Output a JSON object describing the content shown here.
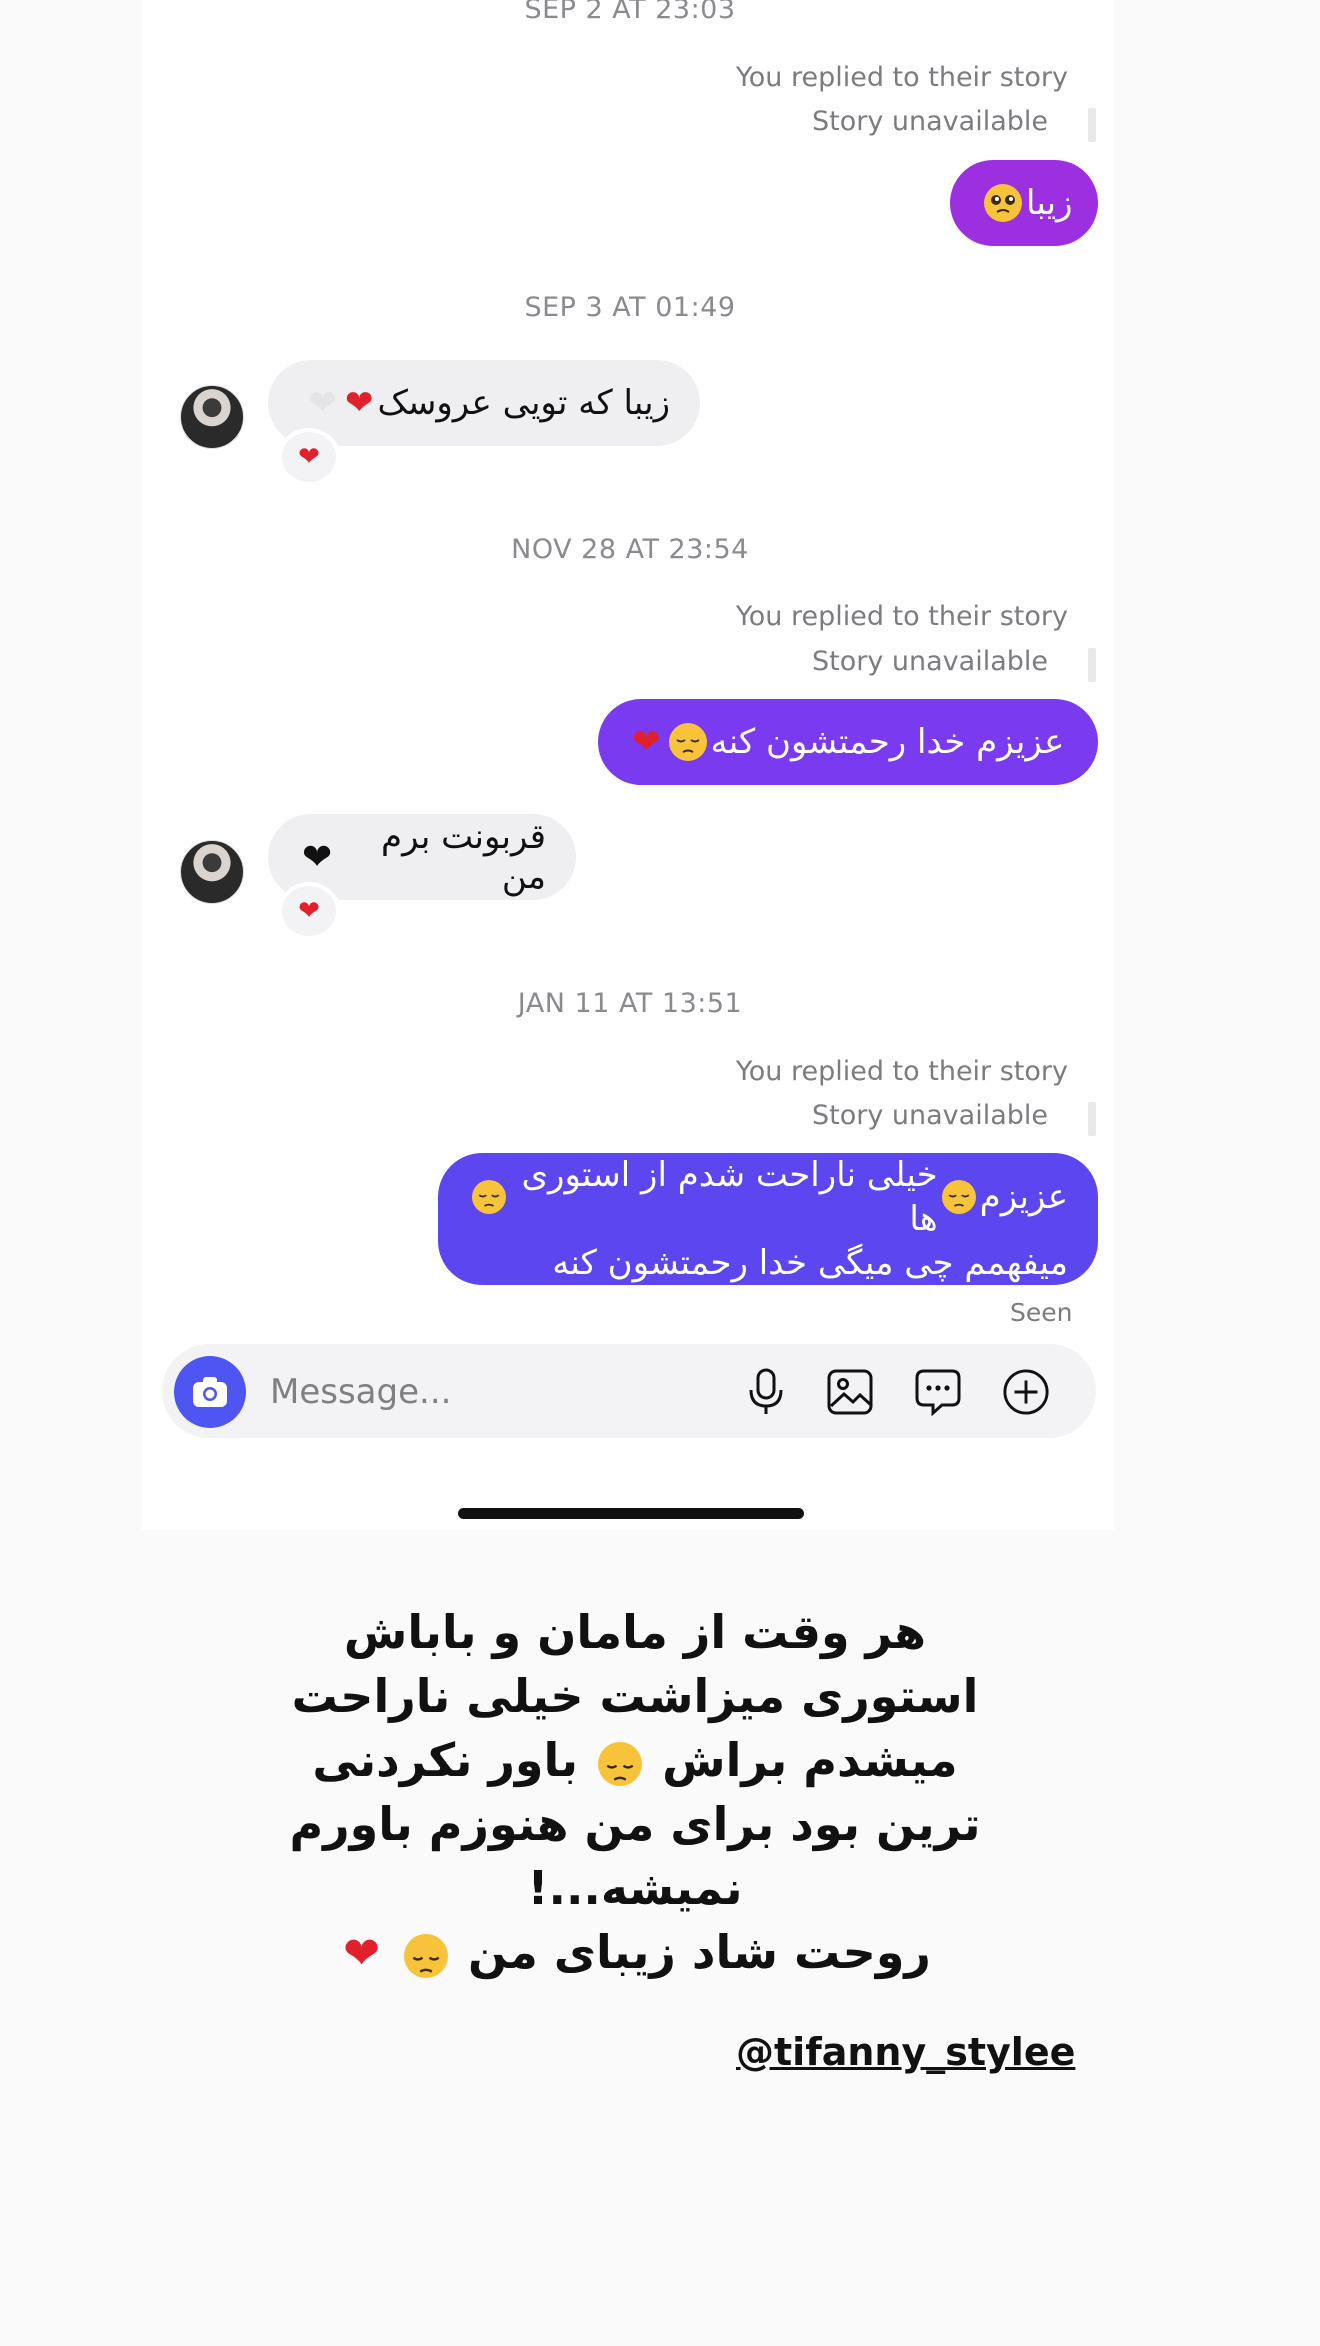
{
  "thread": {
    "groups": [
      {
        "date": "SEP 2 AT 23:03",
        "reply_note": "You replied to their story",
        "story_status": "Story unavailable",
        "outgoing_text": "زیبا",
        "outgoing_emoji": "pleading-face"
      },
      {
        "date": "SEP 3 AT 01:49",
        "incoming_text": "زیبا که تویی عروسک",
        "incoming_emojis": [
          "anatomical-heart",
          "white-heart"
        ],
        "reaction": "❤"
      },
      {
        "date": "NOV 28 AT 23:54",
        "reply_note": "You replied to their story",
        "story_status": "Story unavailable",
        "outgoing_text": "عزیزم خدا رحمتشون کنه",
        "outgoing_emojis": [
          "pensive-face",
          "broken-heart"
        ],
        "incoming_text": "قربونت برم من",
        "incoming_emoji": "black-heart",
        "reaction": "❤"
      },
      {
        "date": "JAN 11 AT 13:51",
        "reply_note": "You replied to their story",
        "story_status": "Story unavailable",
        "outgoing_line1_a": "عزیزم",
        "outgoing_line1_b": "خیلی ناراحت شدم از استوری ها",
        "outgoing_line2": "میفهمم چی میگی خدا رحمتشون کنه",
        "outgoing_emoji": "pensive-face",
        "seen": "Seen"
      }
    ]
  },
  "composer": {
    "placeholder": "Message...",
    "icons": [
      "camera-icon",
      "microphone-icon",
      "gallery-icon",
      "sticker-icon",
      "plus-icon"
    ]
  },
  "caption": {
    "lines": [
      "هر وقت از مامان و باباش",
      "استوری میزاشت خیلی ناراحت",
      "میشدم براش",
      "باور نکردنی",
      "ترین بود برای من هنوزم باورم",
      "نمیشه...!",
      "روحت شاد زیبای من"
    ],
    "handle": "@tifanny_stylee"
  },
  "colors": {
    "bubble_out_1": "#9c2fe0",
    "bubble_out_2": "#7a3af0",
    "bubble_out_3": "#5b46f0",
    "camera": "#4f55f2",
    "bubble_in": "#efeff2"
  }
}
